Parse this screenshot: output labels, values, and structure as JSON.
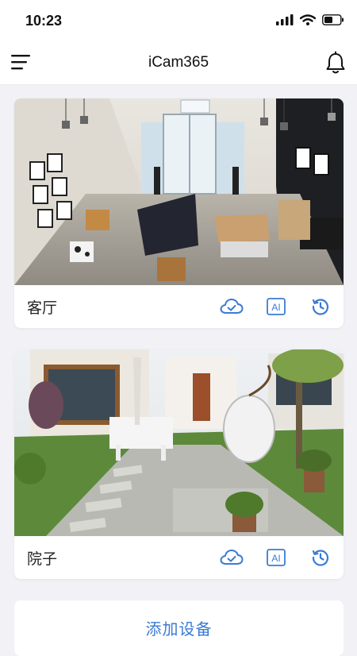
{
  "status_bar": {
    "time": "10:23",
    "icons": [
      "signal-icon",
      "wifi-icon",
      "battery-icon"
    ]
  },
  "header": {
    "title": "iCam365",
    "left_icon": "menu-icon",
    "right_icon": "bell-icon"
  },
  "cameras": [
    {
      "name": "客厅",
      "actions": [
        "cloud-check-icon",
        "ai-icon",
        "history-icon"
      ]
    },
    {
      "name": "院子",
      "actions": [
        "cloud-check-icon",
        "ai-icon",
        "history-icon"
      ]
    }
  ],
  "add_device_label": "添加设备",
  "colors": {
    "accent": "#3b7bd4",
    "background": "#f1f1f6"
  }
}
